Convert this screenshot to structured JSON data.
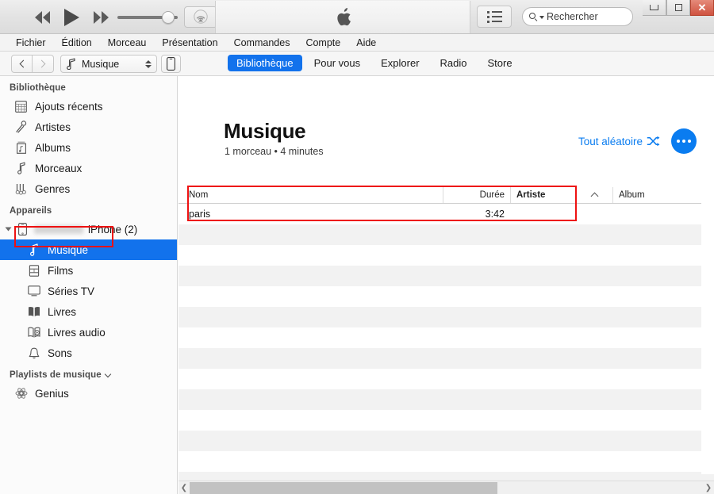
{
  "window": {
    "controls": {
      "minimize": "minimize-icon",
      "maximize": "maximize-icon",
      "close": "✕"
    }
  },
  "player": {
    "rewind_icon": "rewind-icon",
    "play_icon": "play-icon",
    "fastforward_icon": "fast-forward-icon",
    "volume_value": 73,
    "airplay_icon": "airplay-icon",
    "apple_logo": "apple-logo",
    "list_view_icon": "list-view-icon"
  },
  "search": {
    "placeholder": "Rechercher",
    "value": "",
    "icon": "search-icon"
  },
  "menu": {
    "items": [
      {
        "label": "Fichier"
      },
      {
        "label": "Édition"
      },
      {
        "label": "Morceau"
      },
      {
        "label": "Présentation"
      },
      {
        "label": "Commandes"
      },
      {
        "label": "Compte"
      },
      {
        "label": "Aide"
      }
    ]
  },
  "nav": {
    "back_icon": "chevron-left-icon",
    "forward_icon": "chevron-right-icon",
    "media_selector": {
      "label": "Musique",
      "icon": "music-note-icon"
    },
    "device_button_icon": "iphone-icon",
    "tabs": [
      {
        "label": "Bibliothèque",
        "active": true
      },
      {
        "label": "Pour vous",
        "active": false
      },
      {
        "label": "Explorer",
        "active": false
      },
      {
        "label": "Radio",
        "active": false
      },
      {
        "label": "Store",
        "active": false
      }
    ]
  },
  "sidebar": {
    "library_header": "Bibliothèque",
    "library_items": [
      {
        "label": "Ajouts récents",
        "icon": "recently-added-icon"
      },
      {
        "label": "Artistes",
        "icon": "microphone-icon"
      },
      {
        "label": "Albums",
        "icon": "album-icon"
      },
      {
        "label": "Morceaux",
        "icon": "music-note-icon"
      },
      {
        "label": "Genres",
        "icon": "genres-icon"
      }
    ],
    "devices_header": "Appareils",
    "device": {
      "name_redacted": true,
      "label": "iPhone (2)",
      "icon": "iphone-icon"
    },
    "device_items": [
      {
        "label": "Musique",
        "icon": "music-note-icon",
        "selected": true
      },
      {
        "label": "Films",
        "icon": "film-icon",
        "selected": false
      },
      {
        "label": "Séries TV",
        "icon": "tv-icon",
        "selected": false
      },
      {
        "label": "Livres",
        "icon": "book-icon",
        "selected": false
      },
      {
        "label": "Livres audio",
        "icon": "audiobook-icon",
        "selected": false
      },
      {
        "label": "Sons",
        "icon": "bell-icon",
        "selected": false
      }
    ],
    "playlists_header": "Playlists de musique",
    "playlist_items": [
      {
        "label": "Genius",
        "icon": "genius-icon"
      }
    ]
  },
  "main": {
    "title": "Musique",
    "subtitle": "1 morceau • 4 minutes",
    "shuffle_label": "Tout aléatoire",
    "shuffle_icon": "shuffle-icon",
    "more_icon": "more-options-icon",
    "accent_color": "#0a7cf0"
  },
  "table": {
    "columns": [
      {
        "key": "nom",
        "label": "Nom",
        "sorted": false
      },
      {
        "key": "duree",
        "label": "Durée",
        "sorted": false
      },
      {
        "key": "artiste",
        "label": "Artiste",
        "sorted": true
      },
      {
        "key": "album",
        "label": "Album",
        "sorted": false
      }
    ],
    "sort_indicator": "caret-up-icon",
    "rows": [
      {
        "nom": "paris",
        "duree": "3:42",
        "artiste": "",
        "album": ""
      }
    ],
    "empty_row_count": 13
  },
  "scrollbar": {
    "left_arrow": "❮",
    "right_arrow": "❯",
    "thumb_position_pct": 0,
    "thumb_width_pct": 60
  },
  "annotations": {
    "highlight_color": "#ee1111",
    "boxes": [
      {
        "name": "sidebar-musique-highlight"
      },
      {
        "name": "track-row-highlight"
      }
    ]
  }
}
